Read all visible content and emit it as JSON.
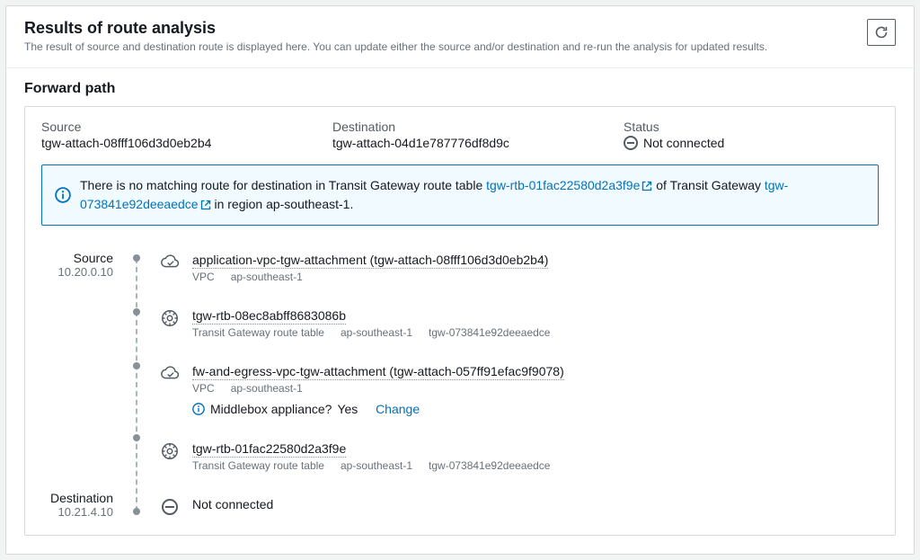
{
  "header": {
    "title": "Results of route analysis",
    "subtitle": "The result of source and destination route is displayed here. You can update either the source and/or destination and re-run the analysis for updated results."
  },
  "forward": {
    "title": "Forward path",
    "source_label": "Source",
    "source_value": "tgw-attach-08fff106d3d0eb2b4",
    "destination_label": "Destination",
    "destination_value": "tgw-attach-04d1e787776df8d9c",
    "status_label": "Status",
    "status_value": "Not connected"
  },
  "alert": {
    "pre": "There is no matching route for destination in Transit Gateway route table ",
    "rt_link": "tgw-rtb-01fac22580d2a3f9e",
    "mid": " of Transit Gateway ",
    "tgw_link": "tgw-073841e92deeaedce",
    "post_prefix": " in region ",
    "region": "ap-southeast-1",
    "post_suffix": "."
  },
  "endpoints": {
    "source_label": "Source",
    "source_ip": "10.20.0.10",
    "destination_label": "Destination",
    "destination_ip": "10.21.4.10"
  },
  "hops": [
    {
      "icon": "vpc",
      "title": "application-vpc-tgw-attachment (tgw-attach-08fff106d3d0eb2b4)",
      "sub": [
        "VPC",
        "ap-southeast-1"
      ]
    },
    {
      "icon": "rt",
      "title": "tgw-rtb-08ec8abff8683086b",
      "sub": [
        "Transit Gateway route table",
        "ap-southeast-1",
        "tgw-073841e92deeaedce"
      ]
    },
    {
      "icon": "vpc",
      "title": "fw-and-egress-vpc-tgw-attachment (tgw-attach-057ff91efac9f9078)",
      "sub": [
        "VPC",
        "ap-southeast-1"
      ],
      "extra": {
        "question": "Middlebox appliance?",
        "answer": "Yes",
        "action": "Change"
      }
    },
    {
      "icon": "rt",
      "title": "tgw-rtb-01fac22580d2a3f9e",
      "sub": [
        "Transit Gateway route table",
        "ap-southeast-1",
        "tgw-073841e92deeaedce"
      ]
    },
    {
      "icon": "minus",
      "title": "Not connected",
      "sub": []
    }
  ]
}
